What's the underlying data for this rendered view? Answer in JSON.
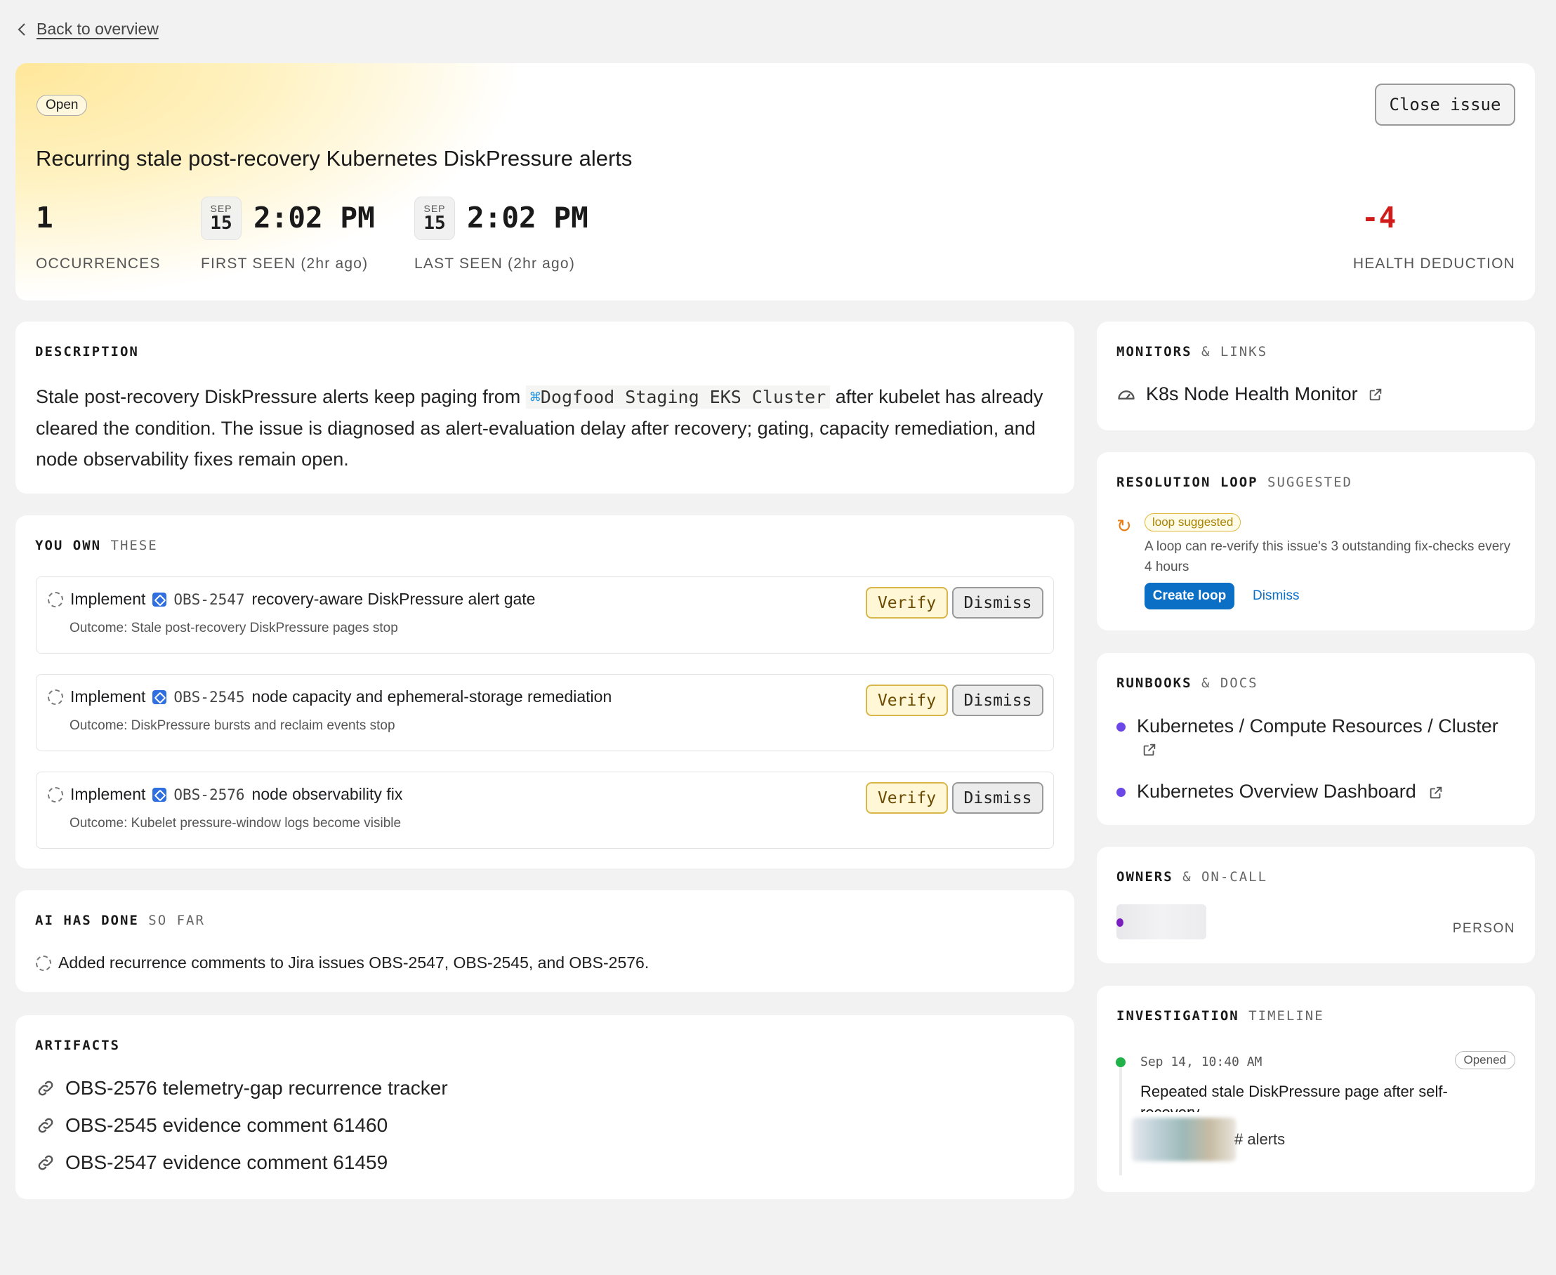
{
  "nav": {
    "back_label": "Back to overview"
  },
  "issue": {
    "status": "Open",
    "close_label": "Close issue",
    "title": "Recurring stale post-recovery Kubernetes DiskPressure alerts",
    "occurrences": "1",
    "occurrences_label": "OCCURRENCES",
    "first_seen": {
      "month": "SEP",
      "day": "15",
      "time": "2:02 PM",
      "label": "FIRST SEEN (2hr ago)"
    },
    "last_seen": {
      "month": "SEP",
      "day": "15",
      "time": "2:02 PM",
      "label": "LAST SEEN (2hr ago)"
    },
    "health_deduction": "-4",
    "health_label": "HEALTH DEDUCTION"
  },
  "description": {
    "heading": "DESCRIPTION",
    "text_before": "Stale post-recovery DiskPressure alerts keep paging from ",
    "cluster": "Dogfood Staging EKS Cluster",
    "text_after": " after kubelet has already cleared the condition. The issue is diagnosed as alert-evaluation delay after recovery; gating, capacity remediation, and node observability fixes remain open."
  },
  "own": {
    "heading_bold": "YOU OWN",
    "heading_muted": "THESE",
    "verify_label": "Verify",
    "dismiss_label": "Dismiss",
    "tasks": [
      {
        "verb": "Implement",
        "key": "OBS-2547",
        "title": "recovery-aware DiskPressure alert gate",
        "outcome": "Outcome: Stale post-recovery DiskPressure pages stop"
      },
      {
        "verb": "Implement",
        "key": "OBS-2545",
        "title": "node capacity and ephemeral-storage remediation",
        "outcome": "Outcome: DiskPressure bursts and reclaim events stop"
      },
      {
        "verb": "Implement",
        "key": "OBS-2576",
        "title": "node observability fix",
        "outcome": "Outcome: Kubelet pressure-window logs become visible"
      }
    ]
  },
  "ai": {
    "heading_bold": "AI HAS DONE",
    "heading_muted": "SO FAR",
    "item": "Added recurrence comments to Jira issues OBS-2547, OBS-2545, and OBS-2576."
  },
  "artifacts": {
    "heading": "ARTIFACTS",
    "items": [
      "OBS-2576 telemetry-gap recurrence tracker",
      "OBS-2545 evidence comment 61460",
      "OBS-2547 evidence comment 61459"
    ]
  },
  "monitors": {
    "heading_bold": "MONITORS",
    "heading_muted": "& LINKS",
    "item": "K8s Node Health Monitor"
  },
  "loop": {
    "heading_bold": "RESOLUTION LOOP",
    "heading_muted": "SUGGESTED",
    "pill": "loop suggested",
    "text": "A loop can re-verify this issue's 3 outstanding fix-checks every 4 hours",
    "create_label": "Create loop",
    "dismiss_label": "Dismiss"
  },
  "runbooks": {
    "heading_bold": "RUNBOOKS",
    "heading_muted": "& DOCS",
    "items": [
      "Kubernetes / Compute Resources / Cluster",
      "Kubernetes Overview Dashboard"
    ]
  },
  "owners": {
    "heading_bold": "OWNERS",
    "heading_muted": "& ON-CALL",
    "role": "PERSON"
  },
  "timeline": {
    "heading_bold": "INVESTIGATION",
    "heading_muted": "TIMELINE",
    "date": "Sep 14, 10:40 AM",
    "badge": "Opened",
    "title": "Repeated stale DiskPressure page after self-recovery",
    "channel": "# alerts"
  },
  "colors": {
    "accent": "#0c6fc6",
    "deduction": "#d11c1c",
    "verify_bg": "#fff7d6",
    "runbook_dot": "#6b47e8",
    "timeline_dot": "#21b34a"
  }
}
